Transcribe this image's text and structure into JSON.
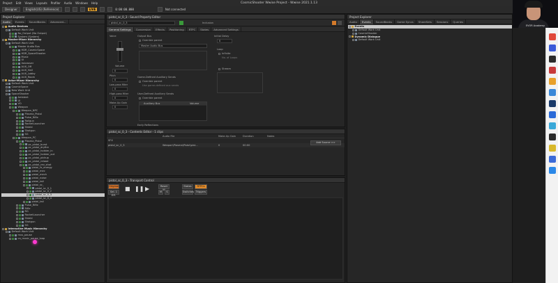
{
  "window": {
    "title": "CosmicShooter Wwise Project - Wwise 2021.1.13",
    "menu": [
      "Project",
      "Edit",
      "Views",
      "Layouts",
      "Profiler",
      "Audio",
      "Windows",
      "Help"
    ],
    "user": "Archivist"
  },
  "toolbar": {
    "layout": "Designer",
    "language": "English(US) (Reference)",
    "live_label": "LIVE",
    "time": "0:00:00.000",
    "connection": "Not connected"
  },
  "project_explorer_left": {
    "title": "Project Explorer",
    "tabs": [
      "Audio",
      "Events",
      "SoundBanks",
      "Advanced..."
    ],
    "rows": [
      {
        "label": "Audio Devices",
        "indent": 0,
        "type": "hdr"
      },
      {
        "label": "Default Work Unit",
        "indent": 1
      },
      {
        "label": "No_Output (No Output)",
        "indent": 2
      },
      {
        "label": "System (System)",
        "indent": 2
      },
      {
        "label": "Master-Mixer Hierarchy",
        "indent": 0,
        "type": "hdr"
      },
      {
        "label": "Default Work Unit",
        "indent": 1
      },
      {
        "label": "Master Audio Bus",
        "indent": 2
      },
      {
        "label": "HDR_CosmicSpace",
        "indent": 3
      },
      {
        "label": "HDR_SpaceShooter",
        "indent": 3
      },
      {
        "label": "Music",
        "indent": 3
      },
      {
        "label": "UI",
        "indent": 3
      },
      {
        "label": "Voiceover",
        "indent": 3
      },
      {
        "label": "AUX_Off",
        "indent": 3
      },
      {
        "label": "AUX_Hall",
        "indent": 3
      },
      {
        "label": "AUX_Lobby",
        "indent": 3
      },
      {
        "label": "AUX_Room",
        "indent": 3
      },
      {
        "label": "Actor-Mixer Hierarchy",
        "indent": 0,
        "type": "hdr"
      },
      {
        "label": "Default Work Unit",
        "indent": 1
      },
      {
        "label": "CosmicSpace",
        "indent": 1
      },
      {
        "label": "New Work Unit",
        "indent": 1
      },
      {
        "label": "SpaceShooter",
        "indent": 1
      },
      {
        "label": "Ambient",
        "indent": 2
      },
      {
        "label": "UI",
        "indent": 2
      },
      {
        "label": "VO",
        "indent": 2
      },
      {
        "label": "Weapon",
        "indent": 2
      },
      {
        "label": "Weapon_NPC",
        "indent": 3
      },
      {
        "label": "Plasma_Pistol",
        "indent": 4
      },
      {
        "label": "Pulse_Rifle",
        "indent": 4
      },
      {
        "label": "Railgun",
        "indent": 4
      },
      {
        "label": "RocketLauncher",
        "indent": 4
      },
      {
        "label": "Shield",
        "indent": 4
      },
      {
        "label": "Shotgun",
        "indent": 4
      },
      {
        "label": "SG",
        "indent": 4
      },
      {
        "label": "Weapon_PC",
        "indent": 3
      },
      {
        "label": "Plasma_Pistol",
        "indent": 4
      },
      {
        "label": "pc_pistol_burst",
        "indent": 5
      },
      {
        "label": "pc_pistol_dryfire",
        "indent": 5
      },
      {
        "label": "pc_pistol_holster_in",
        "indent": 5
      },
      {
        "label": "pc_pistol_holster_out",
        "indent": 5
      },
      {
        "label": "pc_pistol_pickup",
        "indent": 5
      },
      {
        "label": "pc_pistol_reload",
        "indent": 5
      },
      {
        "label": "pc_pistol_rev_shot",
        "indent": 5
      },
      {
        "label": "pistol_fx_energy",
        "indent": 6
      },
      {
        "label": "pistol_mec",
        "indent": 6
      },
      {
        "label": "pistol_mech",
        "indent": 6
      },
      {
        "label": "pistol_noise",
        "indent": 6
      },
      {
        "label": "pistol_tail",
        "indent": 6
      },
      {
        "label": "pistol_sc_",
        "indent": 6
      },
      {
        "label": "pistol_sc_0_1",
        "indent": 7
      },
      {
        "label": "pistol_sc_0_2",
        "indent": 7
      },
      {
        "label": "pistol_sc_0_3",
        "indent": 7,
        "selected": true
      },
      {
        "label": "pistol_sc_0_4",
        "indent": 7
      },
      {
        "label": "pistol_tail",
        "indent": 6
      },
      {
        "label": "Pulse_Rifle",
        "indent": 4
      },
      {
        "label": "Rifle",
        "indent": 4
      },
      {
        "label": "RG",
        "indent": 4
      },
      {
        "label": "RocketLauncher",
        "indent": 4
      },
      {
        "label": "Shield",
        "indent": 4
      },
      {
        "label": "Shotgun",
        "indent": 4
      },
      {
        "label": "SG",
        "indent": 4
      },
      {
        "label": "Interactive Music Hierarchy",
        "indent": 0,
        "type": "hdr"
      },
      {
        "label": "Default Work Unit",
        "indent": 1
      },
      {
        "label": "mus_pause",
        "indent": 2
      },
      {
        "label": "ca_music_pause_loop",
        "indent": 2
      }
    ]
  },
  "property_editor": {
    "title": "pistol_sc_0_3 - Sound Property Editor",
    "name": "pistol_sc_0_3",
    "inclusion_label": "Inclusion",
    "tabs": [
      "General Settings",
      "Conversion",
      "Effects",
      "Positioning",
      "RTPC",
      "States",
      "Advanced Settings"
    ],
    "labels": {
      "voice": "Voice",
      "volume": "Volume",
      "pitch": "Pitch",
      "low_pass": "Low-pass filter",
      "high_pass": "High-pass filter",
      "makeup": "Make-Up Gain",
      "output_bus": "Output Bus",
      "override_parent": "Override parent",
      "bus_value": "Master Audio Bus",
      "game_aux": "Game-Defined Auxiliary Sends",
      "use_game_aux": "Use game-defined aux sends",
      "user_aux": "User-Defined Auxiliary Sends",
      "aux_bus": "Auxiliary Bus",
      "aux_volume": "Volume",
      "early_refl": "Early Reflections",
      "initial_delay": "Initial Delay",
      "loop": "Loop",
      "infinite": "Infinite",
      "no_of_loops": "No. of Loops",
      "stream": "Stream"
    },
    "values": {
      "volume": "0",
      "pitch": "0",
      "low_pass": "0",
      "high_pass": "0",
      "makeup": "0",
      "initial_delay": "0"
    }
  },
  "contents_editor": {
    "title": "pistol_sc_0_3 - Contents Editor - 1 clips",
    "columns": [
      "Audio File",
      "Make-Up Gain",
      "Duration",
      "Notes"
    ],
    "row_sfx": "SFX",
    "row": {
      "name": "pistol_sc_0_3",
      "file": "Weapon\\Plasma\\Pistol\\pist...",
      "gain": "0",
      "duration": "00:00"
    },
    "add_source": "Add Source >>"
  },
  "transport": {
    "title": "pistol_sc_0_3 - Transport Control",
    "original": "Original",
    "auto": "Sel. 1 Eff.",
    "reset_all": "Reset All",
    "states": "States",
    "switches": "Switches",
    "triggers": "Triggers",
    "rtpcs": "RTPCs",
    "mute": "M",
    "solo": "S"
  },
  "project_explorer_right": {
    "title": "Project Explorer",
    "tabs": [
      "Audio",
      "Events",
      "SoundBanks",
      "Game Syncs",
      "ShareSets",
      "Sessions",
      "Queries"
    ],
    "rows": [
      {
        "label": "Events",
        "indent": 0,
        "type": "hdr",
        "selected": true
      },
      {
        "label": "Default Work Unit",
        "indent": 1
      },
      {
        "label": "CosmicShooter",
        "indent": 1
      },
      {
        "label": "Dynamic Dialogue",
        "indent": 0,
        "type": "hdr"
      },
      {
        "label": "Default Work Unit",
        "indent": 1
      }
    ]
  },
  "webcam": {
    "caption": "EVOR Academy"
  },
  "colors": {
    "accent": "#e0a030",
    "selection": "#c9c9c9",
    "original": "#d4732a",
    "rtpc": "#e08a2a"
  }
}
